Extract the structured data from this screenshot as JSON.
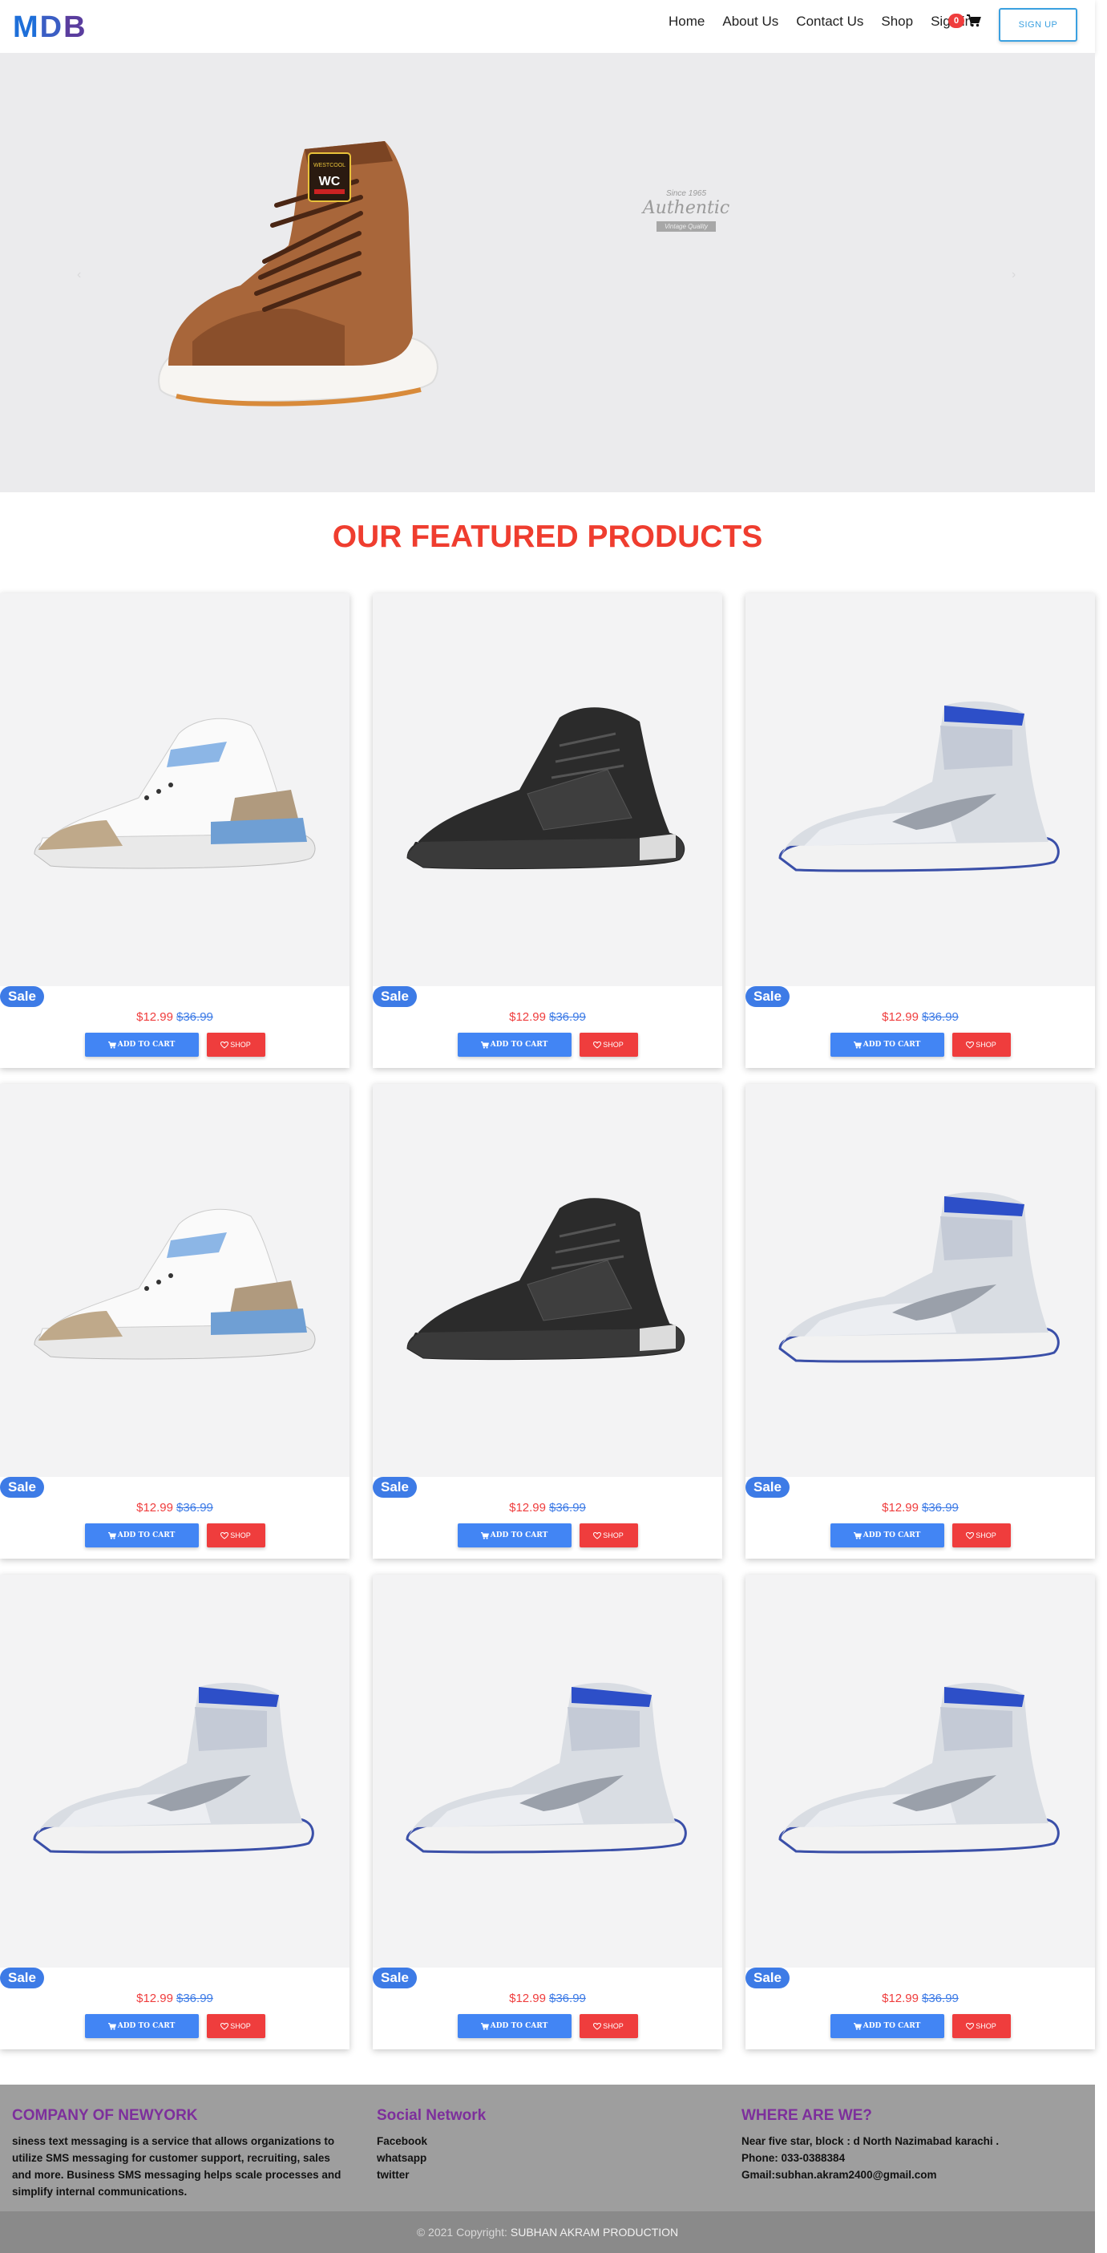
{
  "nav": {
    "logo": [
      "M",
      "D",
      "B"
    ],
    "links": [
      "Home",
      "About Us",
      "Contact Us",
      "Shop",
      "Sign in"
    ],
    "cart_count": "0",
    "signup_label": "SIGN UP"
  },
  "hero": {
    "badge_since": "Since 1965",
    "badge_title": "Authentic",
    "badge_ribbon": "Vintage Quality",
    "shoe_brand": "WESTCOOL",
    "shoe_logo": "WC"
  },
  "featured": {
    "title": "OUR FEATURED PRODUCTS"
  },
  "products": [
    {
      "shoe": "white-jordan-3",
      "sale": "Sale",
      "price": "$12.99",
      "old_price": "$36.99",
      "cart_label": "ADD TO CART",
      "shop_label": "SHOP"
    },
    {
      "shoe": "black-mars-270",
      "sale": "Sale",
      "price": "$12.99",
      "old_price": "$36.99",
      "cart_label": "ADD TO CART",
      "shop_label": "SHOP"
    },
    {
      "shoe": "grey-jordan-1",
      "sale": "Sale",
      "price": "$12.99",
      "old_price": "$36.99",
      "cart_label": "ADD TO CART",
      "shop_label": "SHOP"
    },
    {
      "shoe": "white-jordan-3",
      "sale": "Sale",
      "price": "$12.99",
      "old_price": "$36.99",
      "cart_label": "ADD TO CART",
      "shop_label": "SHOP"
    },
    {
      "shoe": "black-mars-270",
      "sale": "Sale",
      "price": "$12.99",
      "old_price": "$36.99",
      "cart_label": "ADD TO CART",
      "shop_label": "SHOP"
    },
    {
      "shoe": "grey-jordan-1",
      "sale": "Sale",
      "price": "$12.99",
      "old_price": "$36.99",
      "cart_label": "ADD TO CART",
      "shop_label": "SHOP"
    },
    {
      "shoe": "grey-jordan-1",
      "sale": "Sale",
      "price": "$12.99",
      "old_price": "$36.99",
      "cart_label": "ADD TO CART",
      "shop_label": "SHOP"
    },
    {
      "shoe": "grey-jordan-1",
      "sale": "Sale",
      "price": "$12.99",
      "old_price": "$36.99",
      "cart_label": "ADD TO CART",
      "shop_label": "SHOP"
    },
    {
      "shoe": "grey-jordan-1",
      "sale": "Sale",
      "price": "$12.99",
      "old_price": "$36.99",
      "cart_label": "ADD TO CART",
      "shop_label": "SHOP"
    }
  ],
  "footer": {
    "company_title": "COMPANY OF NEWYORK",
    "company_text": "siness text messaging is a service that allows organizations to utilize SMS messaging for customer support, recruiting, sales and more. Business SMS messaging helps scale processes and simplify internal communications.",
    "social_title": "Social Network",
    "social_links": [
      "Facebook",
      "whatsapp",
      "twitter"
    ],
    "where_title": "WHERE ARE WE?",
    "address": "Near five star, block : d North Nazimabad karachi .",
    "phone": "Phone: 033-0388384",
    "email": "Gmail:subhan.akram2400@gmail.com",
    "copyright": "© 2021 Copyright:",
    "copyright_owner": "SUBHAN AKRAM PRODUCTION"
  },
  "colors": {
    "accent_red": "#ef3d3d",
    "accent_blue": "#4285f4",
    "footer_heading": "#7d2f9c",
    "footer_bg": "#9e9e9e"
  }
}
